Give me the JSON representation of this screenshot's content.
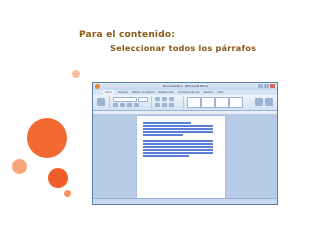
{
  "slide": {
    "title": "Para el contenido:",
    "subtitle": "Seleccionar todos los párrafos"
  },
  "word_window": {
    "title": "Documento1 - Microsoft Word",
    "tabs": [
      "Inicio",
      "Insertar",
      "Diseño de página",
      "Referencias",
      "Correspondencia",
      "Revisar",
      "Vista"
    ],
    "active_tab": 0
  },
  "colors": {
    "title_text": "#8a5a14",
    "accent_orange": "#f26a32",
    "selection": "#5b7fd9"
  }
}
